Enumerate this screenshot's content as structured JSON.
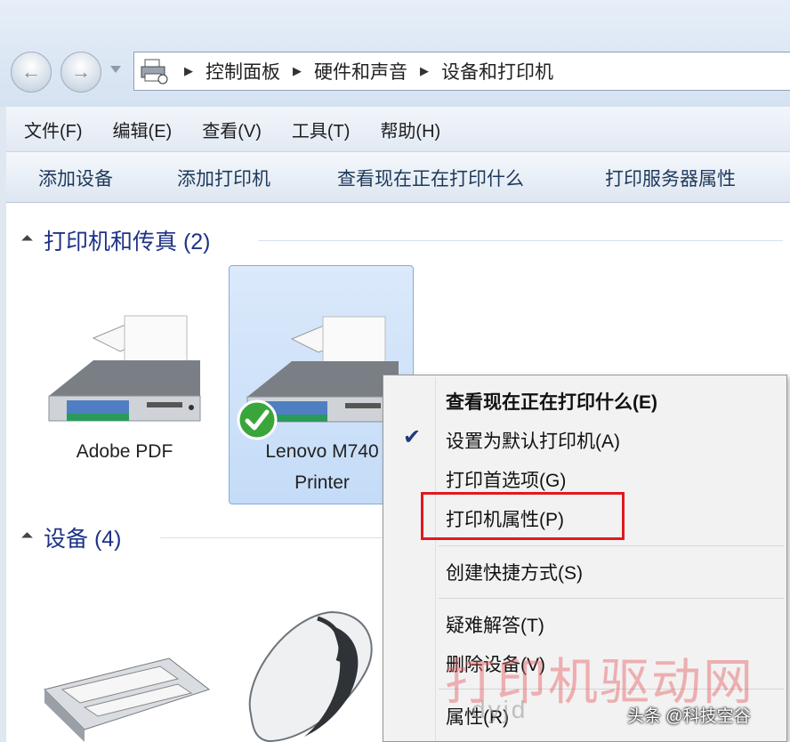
{
  "address": {
    "crumbs": [
      "控制面板",
      "硬件和声音",
      "设备和打印机"
    ]
  },
  "menubar": {
    "items": [
      "文件(F)",
      "编辑(E)",
      "查看(V)",
      "工具(T)",
      "帮助(H)"
    ]
  },
  "toolbar": {
    "items": [
      "添加设备",
      "添加打印机",
      "查看现在正在打印什么",
      "打印服务器属性"
    ]
  },
  "groups": {
    "printers": {
      "title": "打印机和传真 (2)"
    },
    "devices": {
      "title": "设备 (4)"
    }
  },
  "printers": [
    {
      "line1": "Adobe PDF"
    },
    {
      "line1": "Lenovo M740",
      "line2": "Printer",
      "default": true
    }
  ],
  "context_menu": {
    "items": [
      {
        "label": "查看现在正在打印什么(E)",
        "bold": true
      },
      {
        "label": "设置为默认打印机(A)",
        "checked": true
      },
      {
        "label": "打印首选项(G)"
      },
      {
        "label": "打印机属性(P)",
        "highlighted": true
      },
      {
        "label": "创建快捷方式(S)"
      },
      {
        "label": "疑难解答(T)"
      },
      {
        "label": "删除设备(V)"
      },
      {
        "label": "属性(R)"
      }
    ]
  },
  "watermark": {
    "text": "打印机驱动网",
    "url": "dyjd"
  },
  "caption": "头条 @科技空谷",
  "colors": {
    "highlight": "#e0191f",
    "group_title": "#1e3287",
    "toolbar_text": "#1e395b"
  }
}
